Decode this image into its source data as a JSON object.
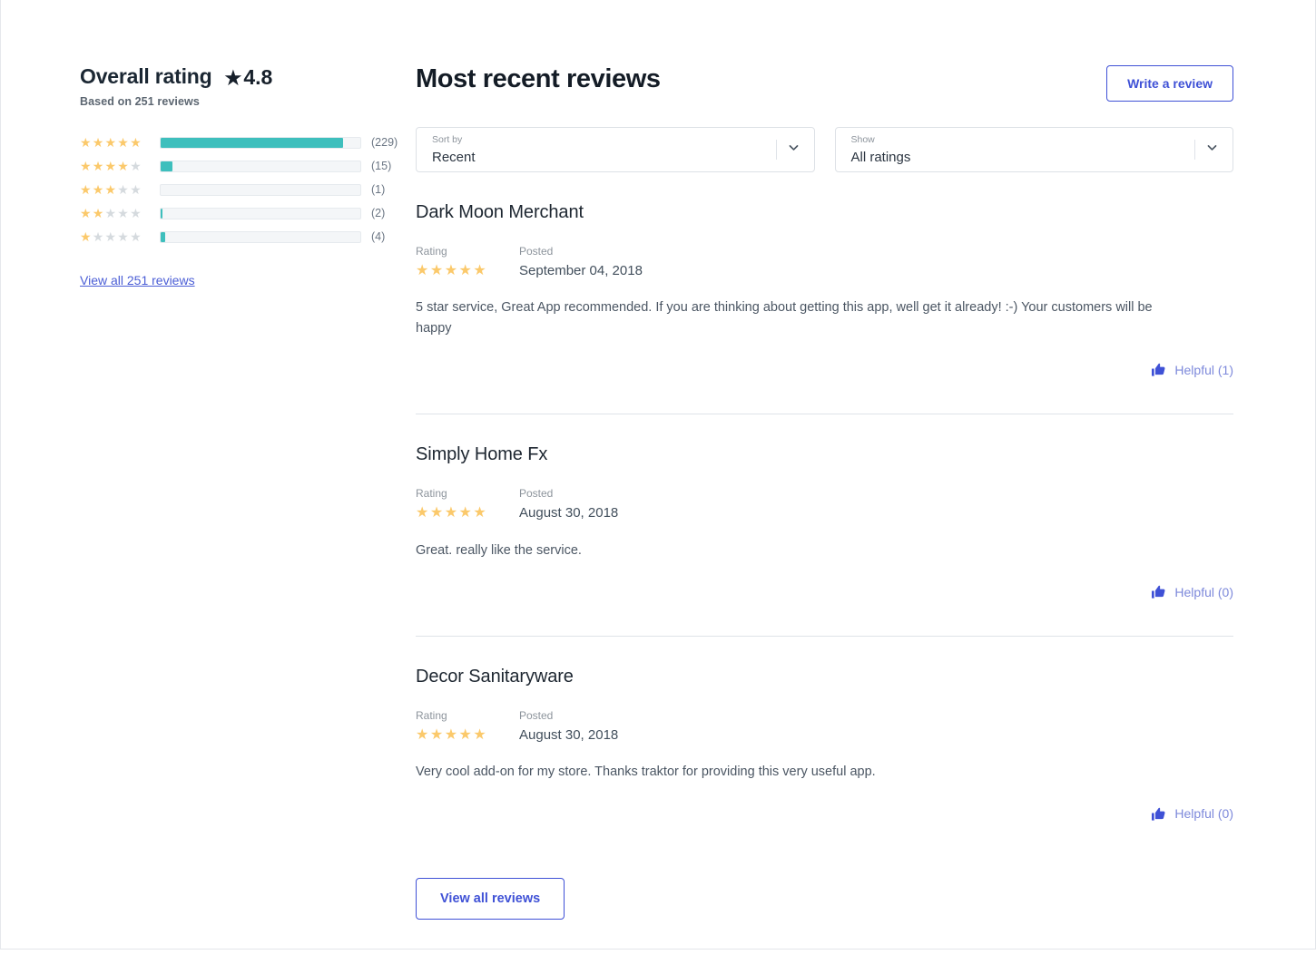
{
  "summary": {
    "title": "Overall rating",
    "score": "4.8",
    "score_star_icon": "star-icon",
    "based_on": "Based on 251 reviews",
    "breakdown": [
      {
        "stars": 5,
        "count_label": "(229)",
        "count": 229,
        "percent": 91.2
      },
      {
        "stars": 4,
        "count_label": "(15)",
        "count": 15,
        "percent": 6.0
      },
      {
        "stars": 3,
        "count_label": "(1)",
        "count": 1,
        "percent": 0.0
      },
      {
        "stars": 2,
        "count_label": "(2)",
        "count": 2,
        "percent": 0.9
      },
      {
        "stars": 1,
        "count_label": "(4)",
        "count": 4,
        "percent": 2.4
      }
    ],
    "view_all_link": "View all 251 reviews"
  },
  "header": {
    "title": "Most recent reviews",
    "write_review_label": "Write a review"
  },
  "filters": [
    {
      "name": "sort-by",
      "label": "Sort by",
      "value": "Recent",
      "icon": "chevron-down-icon"
    },
    {
      "name": "show",
      "label": "Show",
      "value": "All ratings",
      "icon": "chevron-down-icon"
    }
  ],
  "labels": {
    "rating": "Rating",
    "posted": "Posted"
  },
  "reviews": [
    {
      "author": "Dark Moon Merchant",
      "rating": 5,
      "posted": "September 04, 2018",
      "body": "5 star service, Great App recommended. If you are thinking about getting this app, well get it already! :-) Your customers will be happy",
      "helpful_label": "Helpful (1)",
      "helpful_icon": "thumbs-up-icon"
    },
    {
      "author": "Simply Home Fx",
      "rating": 5,
      "posted": "August 30, 2018",
      "body": "Great. really like the service.",
      "helpful_label": "Helpful (0)",
      "helpful_icon": "thumbs-up-icon"
    },
    {
      "author": "Decor Sanitaryware",
      "rating": 5,
      "posted": "August 30, 2018",
      "body": "Very cool add-on for my store. Thanks traktor for providing this very useful app.",
      "helpful_label": "Helpful (0)",
      "helpful_icon": "thumbs-up-icon"
    }
  ],
  "footer": {
    "view_all_reviews_label": "View all reviews"
  },
  "colors": {
    "star_filled": "#fbc96b",
    "star_empty": "#d5dade",
    "bar_fill": "#3ebfbd",
    "bar_track": "#f4f6f8",
    "accent_blue": "#3f51d6",
    "link_blue": "#4b5ed6",
    "helpful_text": "#7d89db",
    "divider": "#dfe3e8"
  }
}
